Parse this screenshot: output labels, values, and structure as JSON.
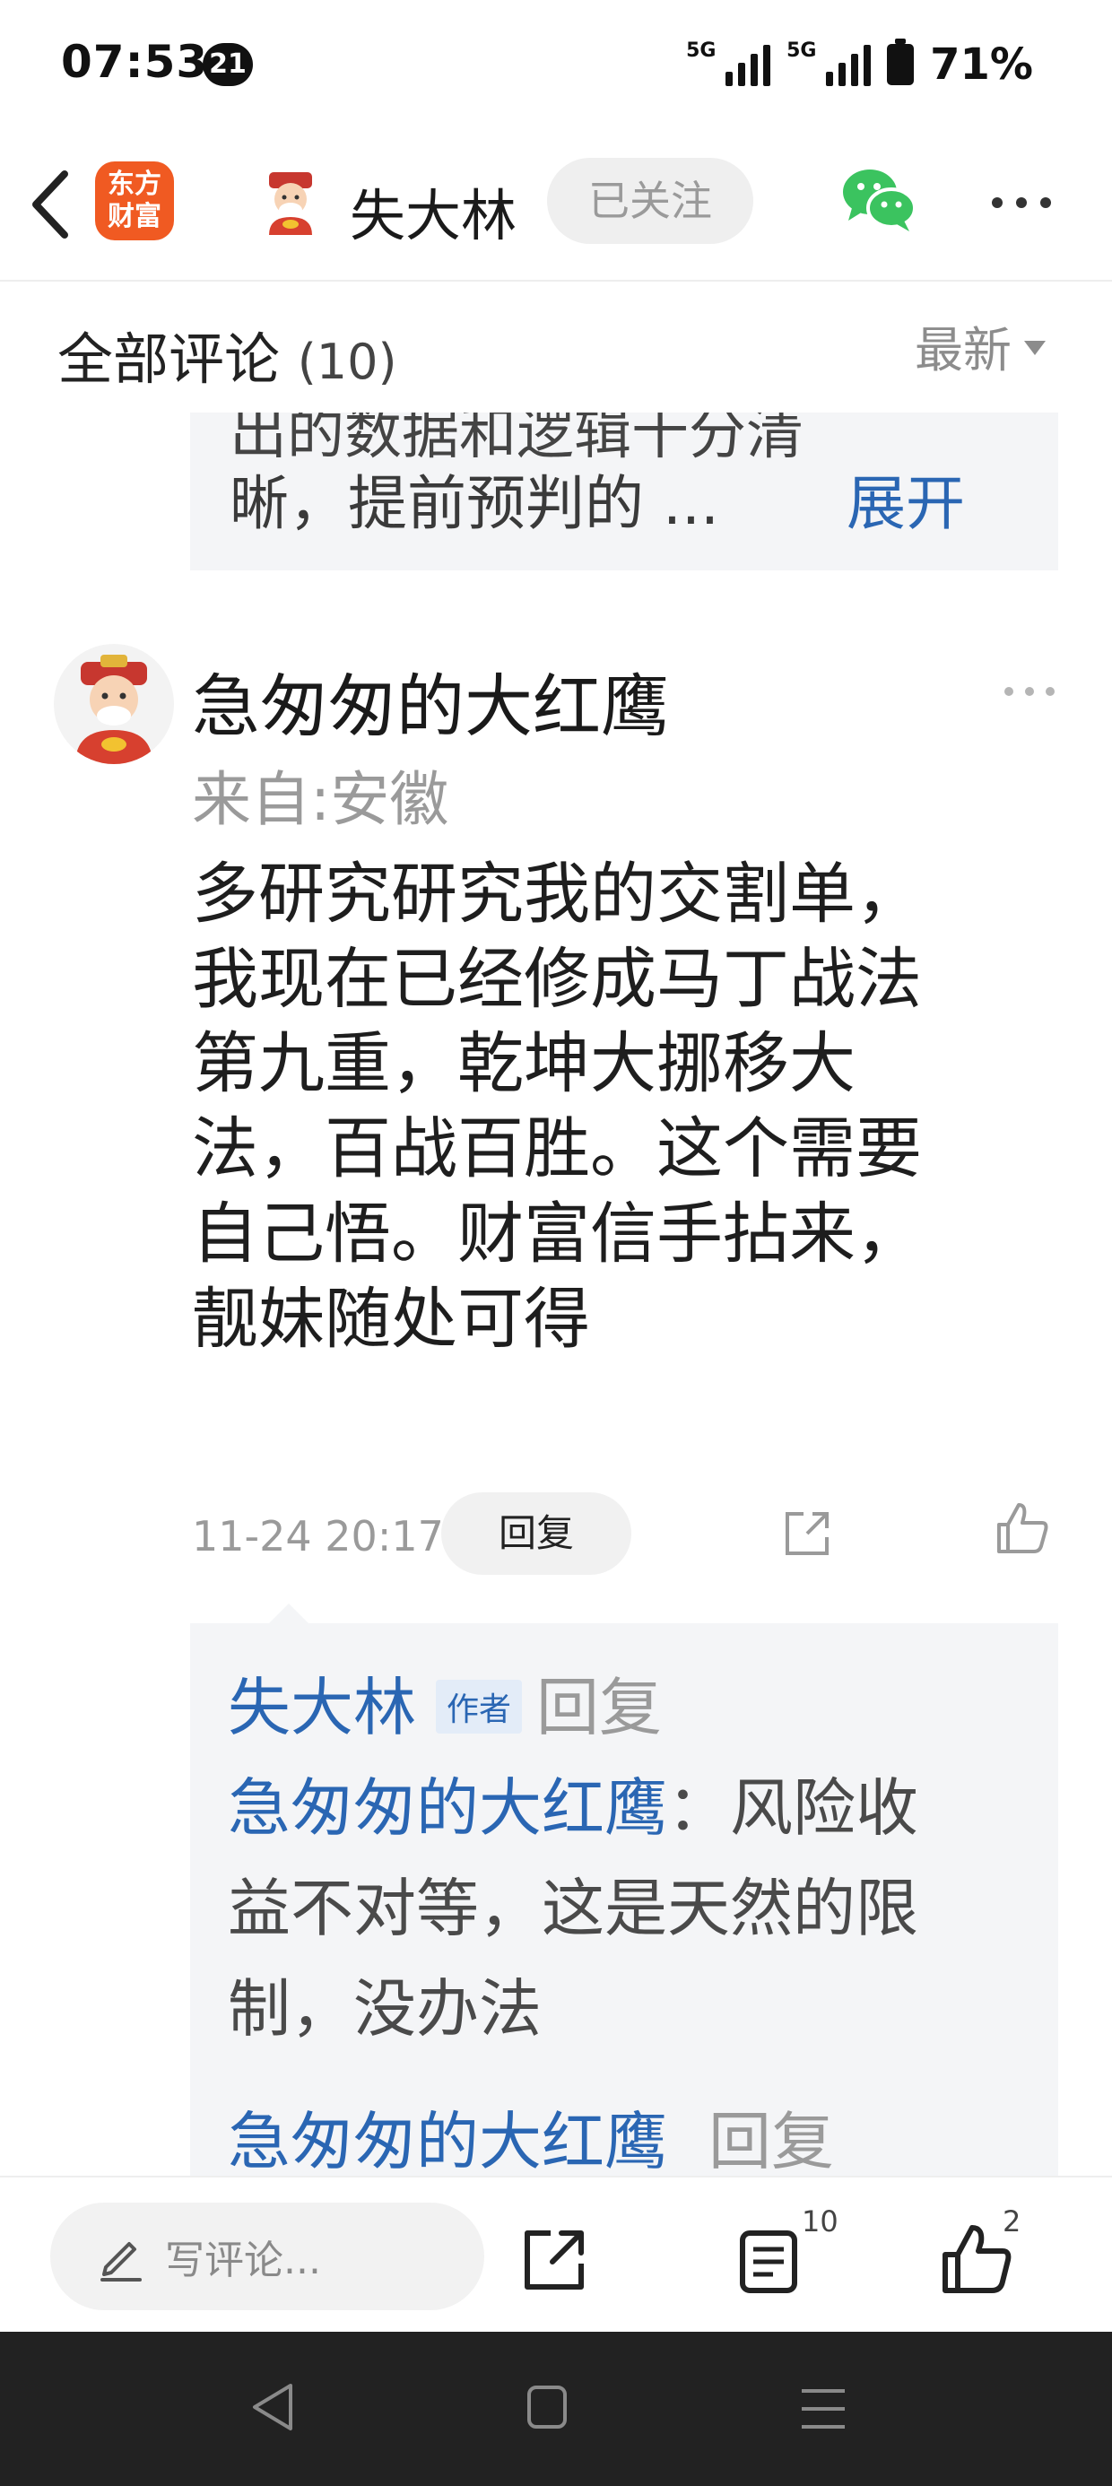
{
  "status_bar": {
    "time": "07:53",
    "notification_badge": "21",
    "signal1_label": "5G",
    "signal2_label": "5G",
    "battery": "71%"
  },
  "header": {
    "app_logo_line1": "东方",
    "app_logo_line2": "财富",
    "author_name": "失大林",
    "follow_label": "已关注",
    "icons": [
      "back-arrow-icon",
      "wechat-icon",
      "more-dots-icon"
    ]
  },
  "comments": {
    "title": "全部评论",
    "count": "(10)",
    "sort_label": "最新",
    "prev_reply": {
      "clipped_text": "出的数据和逻辑十分清",
      "visible_text": "晰，提前预判的 ...",
      "expand_label": "展开"
    },
    "main": {
      "name": "急匆匆的大红鹰",
      "location": "来自:安徽",
      "body_lines": [
        "多研究研究我的交割单，",
        "我现在已经修成马丁战法",
        "第九重，乾坤大挪移大",
        "法，百战百胜。这个需要",
        "自己悟。财富信手拈来，",
        "靓妹随处可得"
      ],
      "time": "11-24 20:17",
      "reply_label": "回复"
    },
    "replies": [
      {
        "name": "失大林",
        "tag": "作者",
        "action": "回复",
        "target": "急匆匆的大红鹰",
        "separator": "：",
        "text_lines": [
          "风险收",
          "益不对等，这是天然的限",
          "制，没办法"
        ]
      },
      {
        "name": "急匆匆的大红鹰",
        "action": "回复"
      }
    ]
  },
  "bottom_bar": {
    "write_placeholder": "写评论...",
    "comments_count": "10",
    "likes_count": "2"
  },
  "colors": {
    "accent_blue": "#2a66b3",
    "logo_orange": "#f05a22",
    "wechat_green": "#3bc35f",
    "muted_gray": "#9a9a9a"
  }
}
